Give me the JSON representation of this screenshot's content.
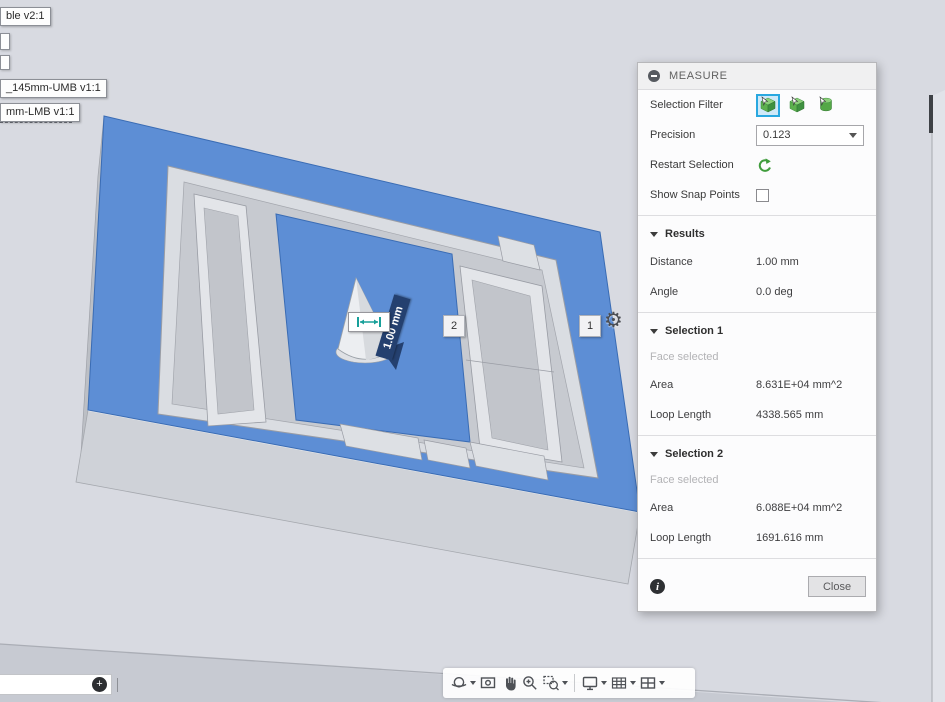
{
  "measure_panel": {
    "title": "MEASURE",
    "selection_filter": {
      "label": "Selection Filter"
    },
    "precision": {
      "label": "Precision",
      "value": "0.123"
    },
    "restart": {
      "label": "Restart Selection"
    },
    "snap": {
      "label": "Show Snap Points",
      "checked": false
    },
    "results": {
      "header": "Results",
      "rows": [
        {
          "label": "Distance",
          "value": "1.00 mm"
        },
        {
          "label": "Angle",
          "value": "0.0 deg"
        }
      ]
    },
    "selection1": {
      "header": "Selection 1",
      "status": "Face selected",
      "rows": [
        {
          "label": "Area",
          "value": "8.631E+04 mm^2"
        },
        {
          "label": "Loop Length",
          "value": "4338.565 mm"
        }
      ]
    },
    "selection2": {
      "header": "Selection 2",
      "status": "Face selected",
      "rows": [
        {
          "label": "Area",
          "value": "6.088E+04 mm^2"
        },
        {
          "label": "Loop Length",
          "value": "1691.616 mm"
        }
      ]
    },
    "close_label": "Close"
  },
  "viewport": {
    "dimension_label": "1.00 mm",
    "badges": [
      "2",
      "1"
    ],
    "component_labels": [
      "ble v2:1",
      "_145mm-UMB v1:1",
      "mm-LMB v1:1"
    ]
  },
  "icons": {
    "gear": "⚙",
    "info": "i",
    "marker": "+"
  },
  "colors": {
    "selection_blue": "#5d8ed5",
    "filter_active_blue": "#29a8e0",
    "tool_green": "#3f9c3c",
    "dimension_navy": "#24406f",
    "measure_teal": "#18a09a",
    "background": "#d8dae1"
  }
}
